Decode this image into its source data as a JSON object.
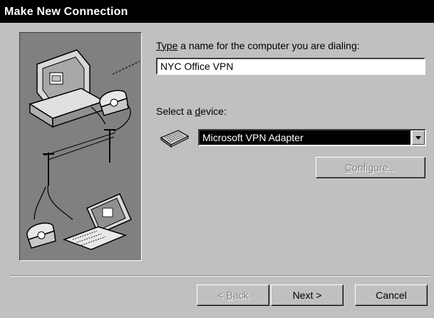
{
  "window": {
    "title": "Make New Connection"
  },
  "form": {
    "name_label_prefix": "Type",
    "name_label_rest": " a name for the computer you are dialing:",
    "name_value": "NYC Office VPN",
    "device_label_prefix": "Select a ",
    "device_label_accel": "d",
    "device_label_rest": "evice:",
    "device_value": "Microsoft VPN Adapter",
    "configure_accel": "C",
    "configure_rest": "onfigure..."
  },
  "buttons": {
    "back_prefix": "< ",
    "back_accel": "B",
    "back_rest": "ack",
    "next": "Next >",
    "cancel": "Cancel"
  },
  "icons": {
    "panel_illustration": "computer-dialing-illustration-icon",
    "device": "network-adapter-icon"
  },
  "colors": {
    "dialog_bg": "#c0c0c0",
    "titlebar_bg": "#000000",
    "selection_bg": "#000000",
    "panel_bg": "#808080"
  }
}
